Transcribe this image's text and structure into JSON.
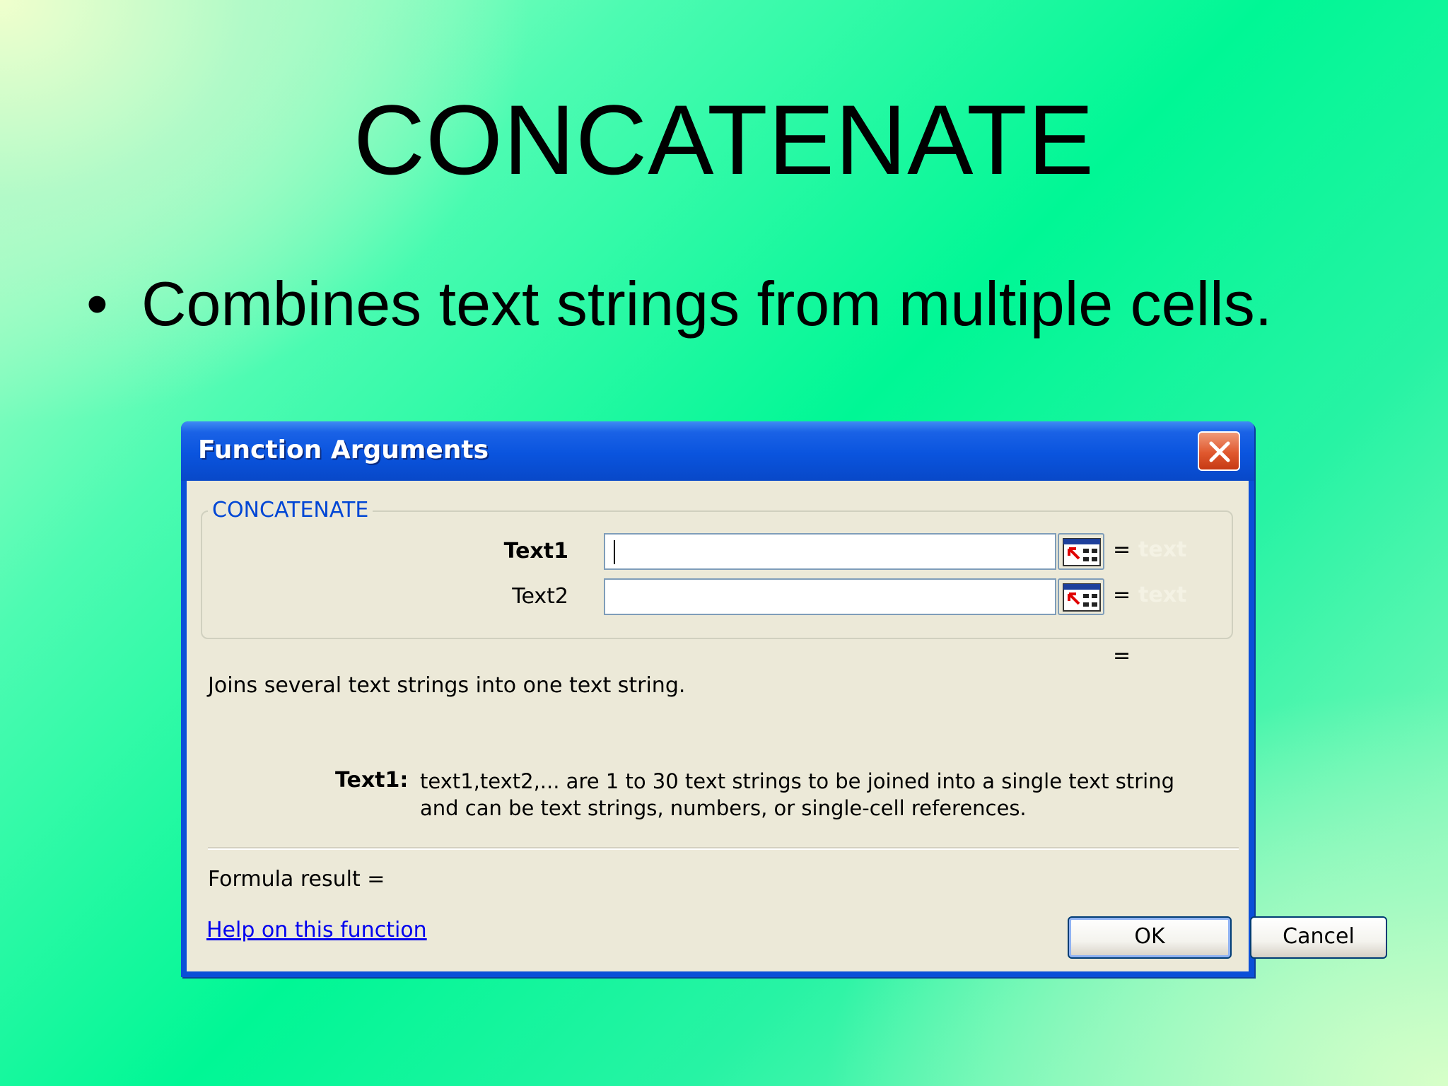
{
  "slide": {
    "title": "CONCATENATE",
    "bullet_symbol": "•",
    "bullet_text": "Combines text strings from multiple cells."
  },
  "dialog": {
    "title": "Function Arguments",
    "group_label": "CONCATENATE",
    "arguments": [
      {
        "label": "Text1",
        "value": "",
        "equals": "=",
        "hint": "text"
      },
      {
        "label": "Text2",
        "value": "",
        "equals": "=",
        "hint": "text"
      }
    ],
    "result_equals": "=",
    "description": "Joins several text strings into one text string.",
    "arg_description_label": "Text1:",
    "arg_description_text": "text1,text2,... are 1 to 30 text strings to be joined into a single text string and can be text strings, numbers, or single-cell references.",
    "formula_result": "Formula result =",
    "help_link": "Help on this function",
    "ok_label": "OK",
    "cancel_label": "Cancel"
  },
  "colors": {
    "titlebar": "#0a54de",
    "dialog_bg": "#ece9d8",
    "group_label": "#0046d5",
    "close_button": "#e0582e",
    "link": "#0000ee"
  }
}
